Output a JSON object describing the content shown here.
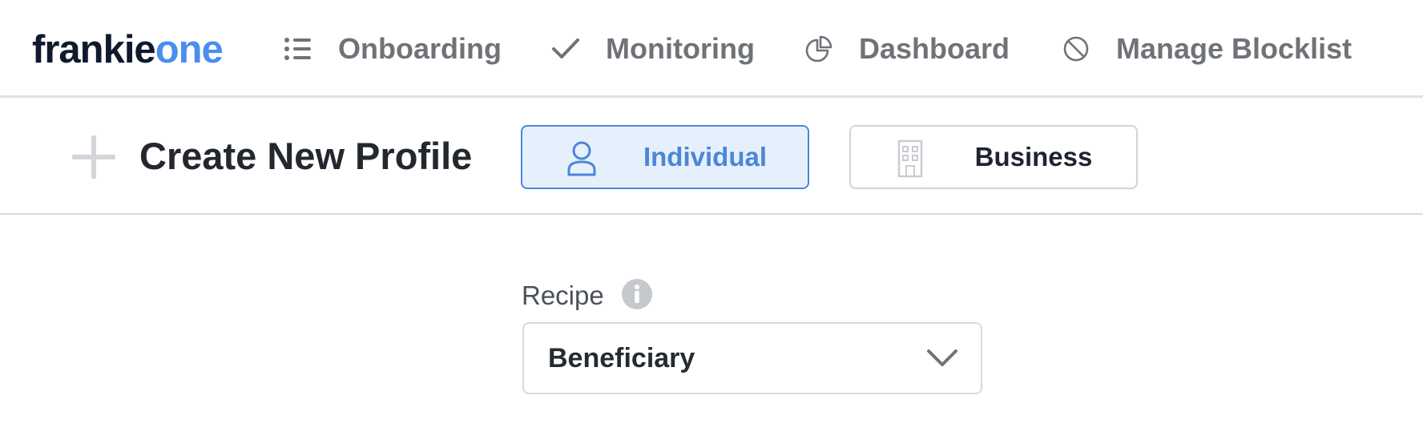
{
  "brand": {
    "logo_part1": "frankie",
    "logo_part2": "one"
  },
  "nav": {
    "items": [
      {
        "label": "Onboarding",
        "icon": "list-icon"
      },
      {
        "label": "Monitoring",
        "icon": "check-icon"
      },
      {
        "label": "Dashboard",
        "icon": "pie-chart-icon"
      },
      {
        "label": "Manage Blocklist",
        "icon": "block-icon"
      }
    ]
  },
  "header": {
    "title": "Create New Profile",
    "profile_types": [
      {
        "label": "Individual",
        "icon": "user-icon",
        "selected": true
      },
      {
        "label": "Business",
        "icon": "building-icon",
        "selected": false
      }
    ]
  },
  "form": {
    "recipe_label": "Recipe",
    "recipe_value": "Beneficiary"
  },
  "colors": {
    "brand_dark": "#10192e",
    "brand_blue": "#4b8df0",
    "selected_bg": "#e6effc",
    "selected_border": "#4b87dd",
    "nav_text": "#6f7378"
  }
}
